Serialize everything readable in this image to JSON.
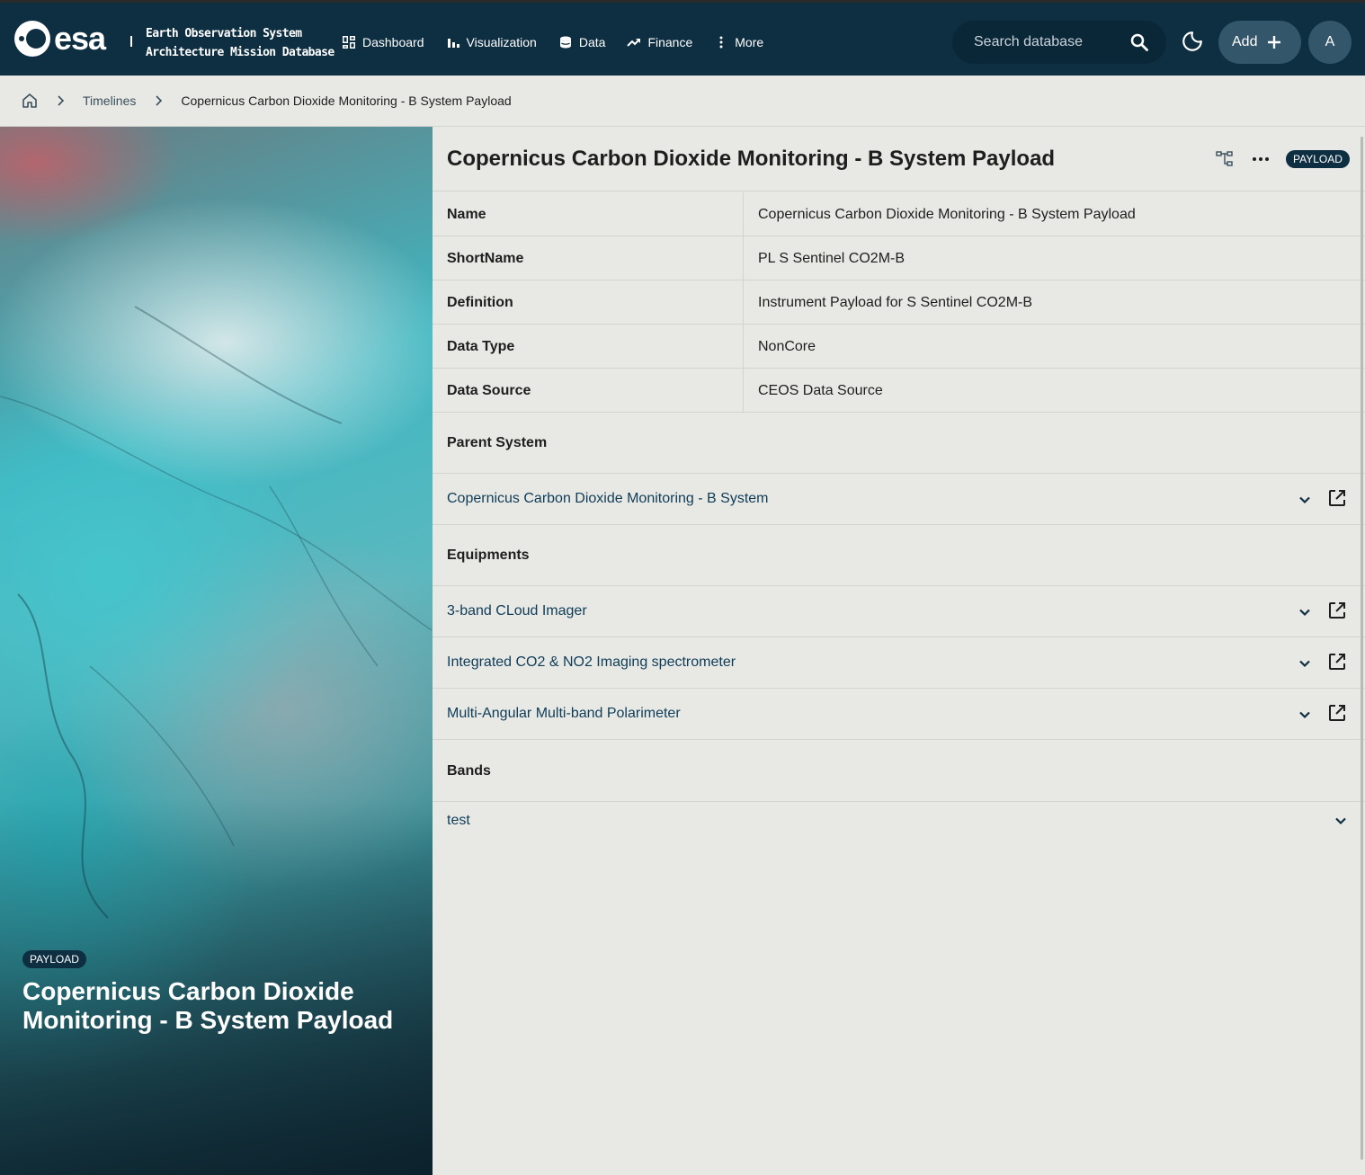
{
  "header": {
    "logo_text": "esa",
    "app_title_line1": "Earth Observation System",
    "app_title_line2": "Architecture Mission Database",
    "nav": [
      {
        "label": "Dashboard",
        "icon": "dashboard-icon"
      },
      {
        "label": "Visualization",
        "icon": "bar-chart-icon"
      },
      {
        "label": "Data",
        "icon": "database-icon"
      },
      {
        "label": "Finance",
        "icon": "trend-icon"
      },
      {
        "label": "More",
        "icon": "more-vertical-icon"
      }
    ],
    "search_placeholder": "Search database",
    "add_label": "Add",
    "avatar_initial": "A"
  },
  "breadcrumb": {
    "items": [
      "Timelines",
      "Copernicus Carbon Dioxide Monitoring - B System Payload"
    ]
  },
  "hero": {
    "badge": "PAYLOAD",
    "title": "Copernicus Carbon Dioxide Monitoring - B System Payload"
  },
  "detail": {
    "title": "Copernicus Carbon Dioxide Monitoring - B System Payload",
    "badge": "PAYLOAD",
    "properties": [
      {
        "key": "Name",
        "value": "Copernicus Carbon Dioxide Monitoring - B System Payload"
      },
      {
        "key": "ShortName",
        "value": "PL S Sentinel CO2M-B"
      },
      {
        "key": "Definition",
        "value": "Instrument Payload for S Sentinel CO2M-B"
      },
      {
        "key": "Data Type",
        "value": "NonCore"
      },
      {
        "key": "Data Source",
        "value": "CEOS Data Source"
      }
    ],
    "parent_system": {
      "title": "Parent System",
      "items": [
        "Copernicus Carbon Dioxide Monitoring - B System"
      ]
    },
    "equipments": {
      "title": "Equipments",
      "items": [
        "3-band CLoud Imager",
        "Integrated CO2 & NO2 Imaging spectrometer",
        "Multi-Angular Multi-band Polarimeter"
      ]
    },
    "bands": {
      "title": "Bands",
      "items": [
        "test"
      ]
    }
  }
}
